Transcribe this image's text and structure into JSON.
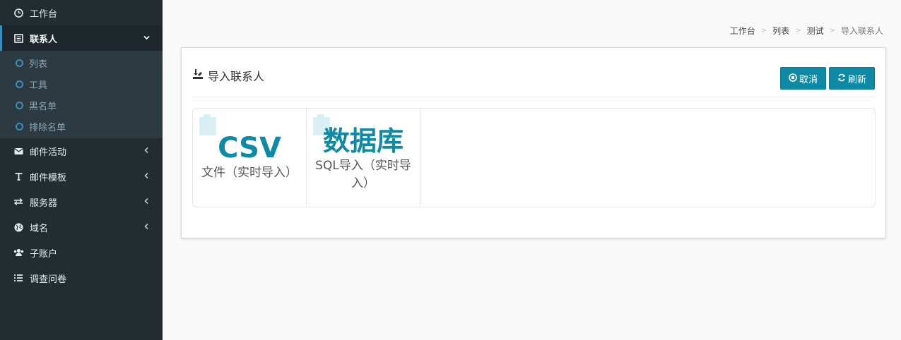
{
  "sidebar": {
    "items": [
      {
        "label": "工作台",
        "icon": "dashboard-icon"
      },
      {
        "label": "联系人",
        "icon": "contacts-icon",
        "expanded": true,
        "active": true
      },
      {
        "label": "邮件活动",
        "icon": "envelope-icon"
      },
      {
        "label": "邮件模板",
        "icon": "text-icon"
      },
      {
        "label": "服务器",
        "icon": "exchange-icon"
      },
      {
        "label": "域名",
        "icon": "globe-icon"
      },
      {
        "label": "子账户",
        "icon": "users-icon"
      },
      {
        "label": "调查问卷",
        "icon": "list-icon"
      }
    ],
    "submenu": [
      "列表",
      "工具",
      "黑名单",
      "排除名单"
    ]
  },
  "breadcrumb": [
    "工作台",
    "列表",
    "测试",
    "导入联系人"
  ],
  "panel": {
    "title": "导入联系人",
    "cancel_label": "取消",
    "refresh_label": "刷新"
  },
  "options": [
    {
      "big": "CSV",
      "sub": "文件（实时导入）"
    },
    {
      "big": "数据库",
      "sub": "SQL导入（实时导入）"
    }
  ],
  "colors": {
    "sidebar_bg": "#222d32",
    "accent": "#0e8aa5",
    "active_border": "#3c8dbc"
  }
}
